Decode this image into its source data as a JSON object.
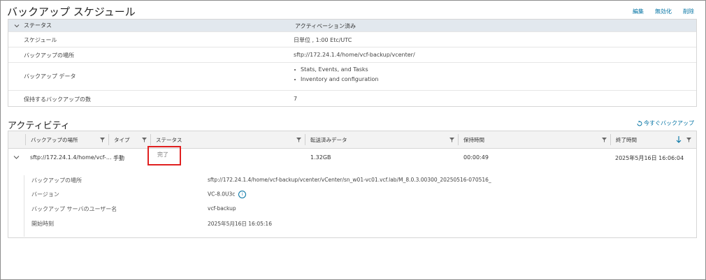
{
  "page_title": "バックアップ スケジュール",
  "actions": {
    "edit": "編集",
    "disable": "無効化",
    "delete": "削除"
  },
  "status": {
    "header_label": "ステータス",
    "header_value": "アクティベーション済み",
    "rows": [
      {
        "key": "スケジュール",
        "value": "日単位 , 1:00 Etc/UTC"
      },
      {
        "key": "バックアップの場所",
        "value": "sftp://172.24.1.4/home/vcf-backup/vcenter/"
      },
      {
        "key": "バックアップ データ",
        "bullets": [
          "Stats, Events, and Tasks",
          "Inventory and configuration"
        ]
      },
      {
        "key": "保持するバックアップの数",
        "value": "7"
      }
    ]
  },
  "activity": {
    "title": "アクティビティ",
    "backup_now": "今すぐバックアップ",
    "columns": [
      "バックアップの場所",
      "タイプ",
      "ステータス",
      "転送済みデータ",
      "保持時間",
      "終了時間"
    ],
    "row": {
      "location": "sftp://172.24.1.4/home/vcf-...",
      "type": "手動",
      "status": "完了",
      "data": "1.32GB",
      "duration": "00:00:49",
      "end_time": "2025年5月16日 16:06:04"
    },
    "details": [
      {
        "key": "バックアップの場所",
        "value": "sftp://172.24.1.4/home/vcf-backup/vcenter/vCenter/sn_w01-vc01.vcf.lab/M_8.0.3.00300_20250516-070516_"
      },
      {
        "key": "バージョン",
        "value": "VC-8.0U3c"
      },
      {
        "key": "バックアップ サーバのユーザー名",
        "value": "vcf-backup"
      },
      {
        "key": "開始時刻",
        "value": "2025年5月16日 16:05:16"
      }
    ]
  },
  "colors": {
    "link": "#0072a3",
    "header_bg": "#e2e8ee",
    "highlight": "#e02020"
  }
}
